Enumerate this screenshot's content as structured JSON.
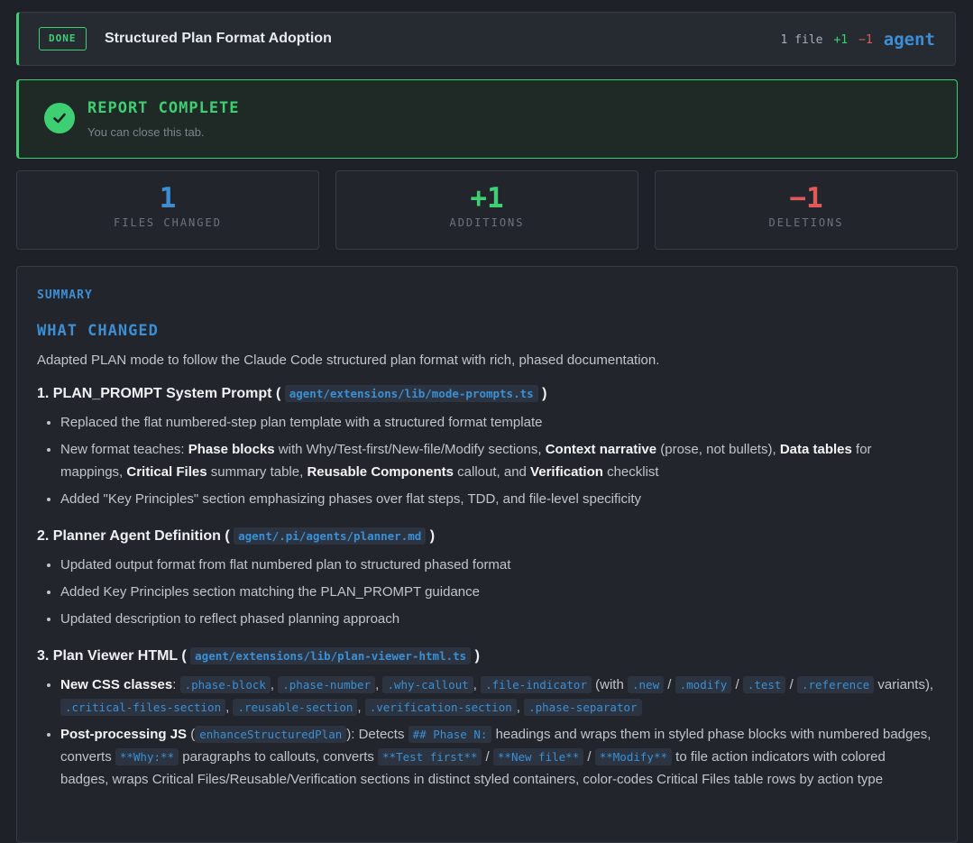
{
  "header": {
    "status": "DONE",
    "title": "Structured Plan Format Adoption",
    "files": "1 file",
    "additions": "+1",
    "deletions": "−1",
    "brand": "agent"
  },
  "report": {
    "title": "REPORT COMPLETE",
    "subtitle": "You can close this tab."
  },
  "stats": [
    {
      "value": "1",
      "label": "FILES CHANGED",
      "color": "#3c8fd4"
    },
    {
      "value": "+1",
      "label": "ADDITIONS",
      "color": "#3ecf72"
    },
    {
      "value": "−1",
      "label": "DELETIONS",
      "color": "#e05a5a"
    }
  ],
  "summary": {
    "label": "SUMMARY",
    "heading": "WHAT CHANGED",
    "intro": "Adapted PLAN mode to follow the Claude Code structured plan format with rich, phased documentation.",
    "s1": {
      "title_pre": "1. PLAN_PROMPT System Prompt (",
      "path": "agent/extensions/lib/mode-prompts.ts",
      "title_post": ")",
      "b1": "Replaced the flat numbered-step plan template with a structured format template",
      "b2": {
        "t1": "New format teaches: ",
        "k1": "Phase blocks",
        "t2": " with Why/Test-first/New-file/Modify sections, ",
        "k2": "Context narrative",
        "t3": " (prose, not bullets), ",
        "k3": "Data tables",
        "t4": " for mappings, ",
        "k4": "Critical Files",
        "t5": " summary table, ",
        "k5": "Reusable Components",
        "t6": " callout, and ",
        "k6": "Verification",
        "t7": " checklist"
      },
      "b3": "Added \"Key Principles\" section emphasizing phases over flat steps, TDD, and file-level specificity"
    },
    "s2": {
      "title_pre": "2. Planner Agent Definition (",
      "path": "agent/.pi/agents/planner.md",
      "title_post": ")",
      "b1": "Updated output format from flat numbered plan to structured phased format",
      "b2": "Added Key Principles section matching the PLAN_PROMPT guidance",
      "b3": "Updated description to reflect phased planning approach"
    },
    "s3": {
      "title_pre": "3. Plan Viewer HTML (",
      "path": "agent/extensions/lib/plan-viewer-html.ts",
      "title_post": ")",
      "b1": {
        "k1": "New CSS classes",
        "t1": ": ",
        "c1": ".phase-block",
        "c2": ".phase-number",
        "c3": ".why-callout",
        "c4": ".file-indicator",
        "t2": " (with ",
        "c5": ".new",
        "c6": ".modify",
        "c7": ".test",
        "c8": ".reference",
        "t3": " variants), ",
        "c9": ".critical-files-section",
        "c10": ".reusable-section",
        "c11": ".verification-section",
        "c12": ".phase-separator",
        "comma": ", ",
        "slash": " / "
      },
      "b2": {
        "k1": "Post-processing JS",
        "t1": " (",
        "c1": "enhanceStructuredPlan",
        "t2": "): Detects ",
        "c2": "## Phase N:",
        "t3": " headings and wraps them in styled phase blocks with numbered badges, converts ",
        "c3": "**Why:**",
        "t4": " paragraphs to callouts, converts ",
        "c4": "**Test first**",
        "c5": "**New file**",
        "c6": "**Modify**",
        "t5": " to file action indicators with colored badges, wraps Critical Files/Reusable/Verification sections in distinct styled containers, color-codes Critical Files table rows by action type",
        "slash": " / "
      }
    }
  }
}
